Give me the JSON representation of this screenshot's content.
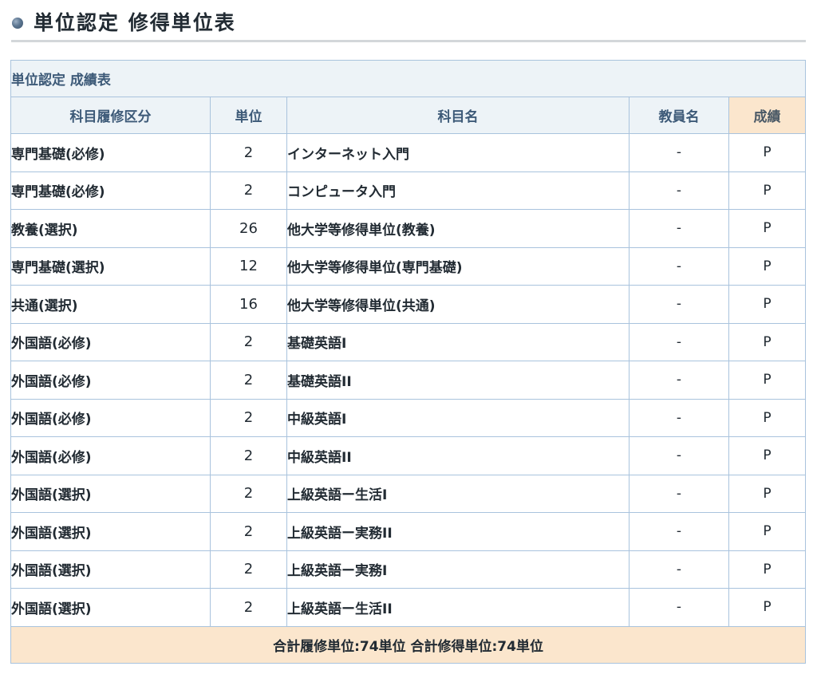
{
  "heading": {
    "title": "単位認定 修得単位表"
  },
  "table": {
    "caption": "単位認定 成績表",
    "columns": [
      "科目履修区分",
      "単位",
      "科目名",
      "教員名",
      "成績"
    ],
    "rows": [
      {
        "category": "専門基礎(必修)",
        "units": "2",
        "subject": "インターネット入門",
        "teacher": "-",
        "grade": "P"
      },
      {
        "category": "専門基礎(必修)",
        "units": "2",
        "subject": "コンピュータ入門",
        "teacher": "-",
        "grade": "P"
      },
      {
        "category": "教養(選択)",
        "units": "26",
        "subject": "他大学等修得単位(教養)",
        "teacher": "-",
        "grade": "P"
      },
      {
        "category": "専門基礎(選択)",
        "units": "12",
        "subject": "他大学等修得単位(専門基礎)",
        "teacher": "-",
        "grade": "P"
      },
      {
        "category": "共通(選択)",
        "units": "16",
        "subject": "他大学等修得単位(共通)",
        "teacher": "-",
        "grade": "P"
      },
      {
        "category": "外国語(必修)",
        "units": "2",
        "subject": "基礎英語I",
        "teacher": "-",
        "grade": "P"
      },
      {
        "category": "外国語(必修)",
        "units": "2",
        "subject": "基礎英語II",
        "teacher": "-",
        "grade": "P"
      },
      {
        "category": "外国語(必修)",
        "units": "2",
        "subject": "中級英語I",
        "teacher": "-",
        "grade": "P"
      },
      {
        "category": "外国語(必修)",
        "units": "2",
        "subject": "中級英語II",
        "teacher": "-",
        "grade": "P"
      },
      {
        "category": "外国語(選択)",
        "units": "2",
        "subject": "上級英語ー生活I",
        "teacher": "-",
        "grade": "P"
      },
      {
        "category": "外国語(選択)",
        "units": "2",
        "subject": "上級英語ー実務II",
        "teacher": "-",
        "grade": "P"
      },
      {
        "category": "外国語(選択)",
        "units": "2",
        "subject": "上級英語ー実務I",
        "teacher": "-",
        "grade": "P"
      },
      {
        "category": "外国語(選択)",
        "units": "2",
        "subject": "上級英語ー生活II",
        "teacher": "-",
        "grade": "P"
      }
    ],
    "footer": "合計履修単位:74単位 合計修得単位:74単位"
  },
  "colors": {
    "header_bg": "#edf3f7",
    "header_text": "#3d5a78",
    "grade_header_bg": "#fbe6cd",
    "footer_bg": "#fbe6cd",
    "border": "#a9c3dd"
  }
}
